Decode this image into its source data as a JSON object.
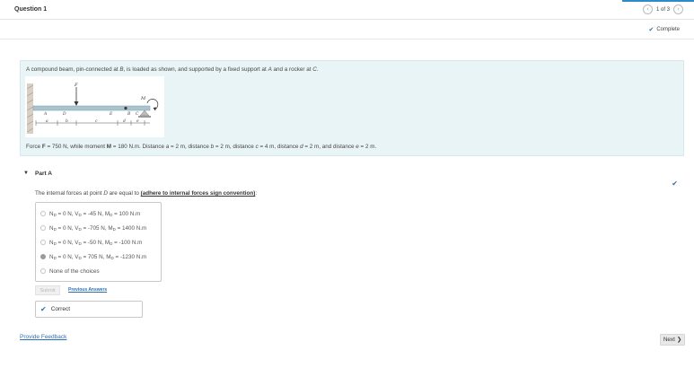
{
  "header": {
    "title": "Question 1",
    "pager": {
      "text": "1 of 3",
      "prev_glyph": "‹",
      "next_glyph": "›"
    },
    "status": "Complete"
  },
  "problem": {
    "intro": {
      "p1": "A compound beam, pin-connected at ",
      "B": "B",
      "p2": ", is loaded as shown, and supported by a fixed support at ",
      "A": "A",
      "p3": " and a rocker at ",
      "C": "C",
      "p4": "."
    },
    "figure": {
      "labels": {
        "F": "F",
        "M": "M",
        "A": "A",
        "D": "D",
        "B": "B",
        "E": "E",
        "C": "C",
        "a": "a",
        "b": "b",
        "c": "c",
        "d": "d",
        "e": "e"
      }
    },
    "givens": {
      "p1": "Force ",
      "F": "F",
      "p2": " = 750 N, while moment ",
      "M": "M",
      "p3": " = 180 N.m. Distance ",
      "a": "a",
      "p4": " = 2 m, distance ",
      "b": "b",
      "p5": " = 2 m, distance ",
      "c": "c",
      "p6": " = 4 m, distance ",
      "d": "d",
      "p7": " = 2 m, and distance ",
      "e": "e",
      "p8": " = 2 m."
    }
  },
  "partA": {
    "label": "Part A",
    "question": {
      "p1": "The internal forces at point ",
      "D": "D",
      "p2": " are equal to ",
      "link": "(adhere to internal forces sign convention)",
      "p3": ":"
    },
    "choices": [
      {
        "n": "N",
        "sub": "D",
        "nv": " = 0 N, ",
        "v": "V",
        "vv": " = -45 N, ",
        "m": "M",
        "mv": " = 100 N.m",
        "selected": false
      },
      {
        "n": "N",
        "sub": "D",
        "nv": " = 0 N, ",
        "v": "V",
        "vv": " = -705 N, ",
        "m": "M",
        "mv": " = 1400 N.m",
        "selected": false
      },
      {
        "n": "N",
        "sub": "D",
        "nv": " = 0 N, ",
        "v": "V",
        "vv": " = -50 N, ",
        "m": "M",
        "mv": " = -100 N.m",
        "selected": false
      },
      {
        "n": "N",
        "sub": "D",
        "nv": " = 0 N, ",
        "v": "V",
        "vv": " = 705 N, ",
        "m": "M",
        "mv": " = -1230 N.m",
        "selected": true
      }
    ],
    "none_choice": "None of the choices",
    "submit_label": "Submit",
    "previous_answers": "Previous Answers",
    "result": "Correct"
  },
  "footer": {
    "feedback": "Provide Feedback",
    "next_label": "Next",
    "next_glyph": "❯"
  },
  "colors": {
    "accent": "#2d6fb5",
    "problem_bg": "#e9f4f7",
    "beam": "#a9c3cf"
  }
}
